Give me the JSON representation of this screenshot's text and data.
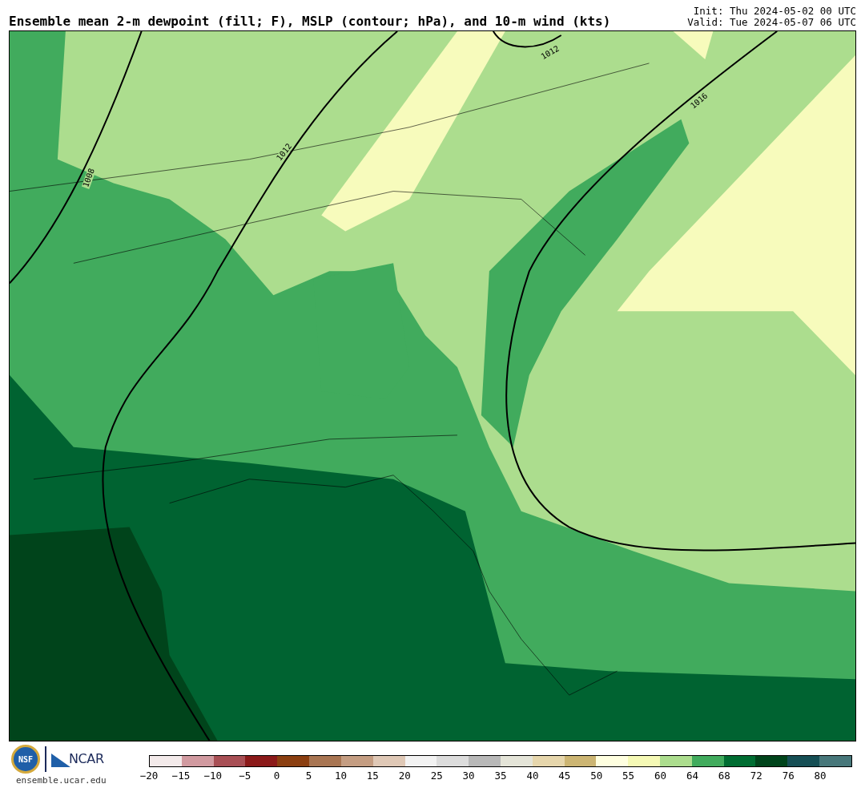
{
  "title": "Ensemble mean 2-m dewpoint (fill; F), MSLP (contour; hPa), and 10-m wind (kts)",
  "init": "Init: Thu 2024-05-02 00 UTC",
  "valid": "Valid: Tue 2024-05-07 06 UTC",
  "map": {
    "contour_labels": [
      "1008",
      "1012",
      "1012",
      "1016"
    ]
  },
  "footer": {
    "nsf_logo": "NSF",
    "ncar_logo": "NCAR",
    "url": "ensemble.ucar.edu"
  },
  "colorbar": {
    "swatches": [
      {
        "color": "#f3eaea"
      },
      {
        "color": "#d19aa0"
      },
      {
        "color": "#a84f55"
      },
      {
        "color": "#8b1a1a"
      },
      {
        "color": "#8b3f11"
      },
      {
        "color": "#a87552"
      },
      {
        "color": "#c49d82"
      },
      {
        "color": "#dfc8b6"
      },
      {
        "color": "#f2f2f2"
      },
      {
        "color": "#dcdcdc"
      },
      {
        "color": "#b8b8b8"
      },
      {
        "color": "#e4e4d8"
      },
      {
        "color": "#e6d6ac"
      },
      {
        "color": "#ccb573"
      },
      {
        "color": "#ffffe0"
      },
      {
        "color": "#f5f9b5"
      },
      {
        "color": "#acdd8e"
      },
      {
        "color": "#41ab5d"
      },
      {
        "color": "#006d32"
      },
      {
        "color": "#00441b"
      },
      {
        "color": "#164f55"
      },
      {
        "color": "#47777a"
      }
    ],
    "ticks": [
      "−20",
      "−15",
      "−10",
      "−5",
      "0",
      "5",
      "10",
      "15",
      "20",
      "25",
      "30",
      "35",
      "40",
      "45",
      "50",
      "55",
      "60",
      "64",
      "68",
      "72",
      "76",
      "80"
    ]
  }
}
